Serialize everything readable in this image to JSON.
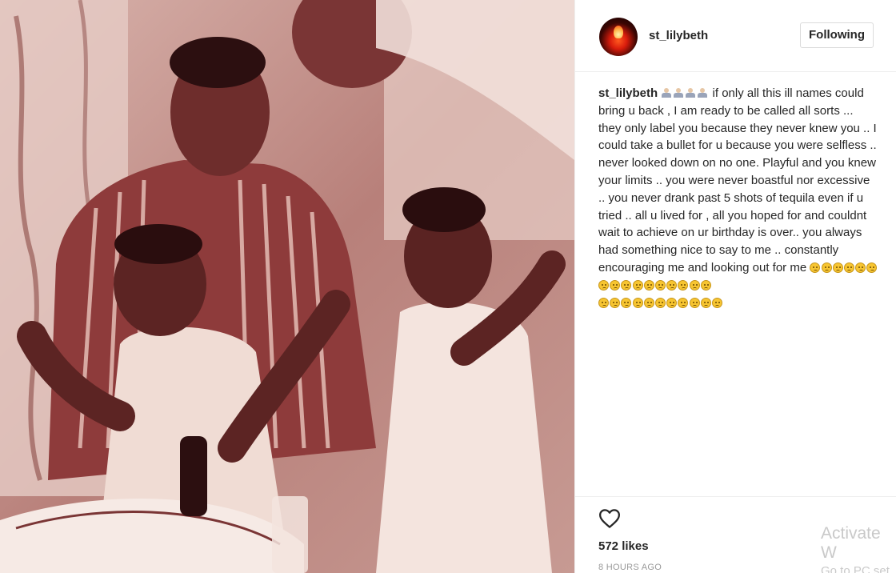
{
  "photo": {
    "alt_icon": "family-birthday-photo"
  },
  "header": {
    "username": "st_lilybeth",
    "follow_label": "Following"
  },
  "caption": {
    "username": "st_lilybeth",
    "line1": "if only all this ill names could bring u back , I am ready to be called all sorts ... they only label you because they never knew you .. I could take a bullet for u because you were selfless .. never looked down on no one. Playful and you knew your limits .. you were never boastful nor excessive .. you never drank past 5 shots of tequila even if u tried .. all u lived for , all you hoped for and couldnt wait to achieve on ur birthday is over.. you always had something nice to say to me .. constantly encouraging me and looking out for me",
    "pray_count": 4,
    "sad_count_line1": 16,
    "sad_count_line2": 11,
    "emoji_names": [
      "pray-emoji",
      "sad-face-emoji"
    ]
  },
  "actions": {
    "likes": "572 likes",
    "time": "8 HOURS AGO"
  },
  "watermark": {
    "line1": "Activate W",
    "line2": "Go to PC set"
  },
  "colors": {
    "photo_tint": "#b67d75",
    "border": "#efefef",
    "muted": "#999999",
    "emoji_yellow": "#f7c531"
  }
}
